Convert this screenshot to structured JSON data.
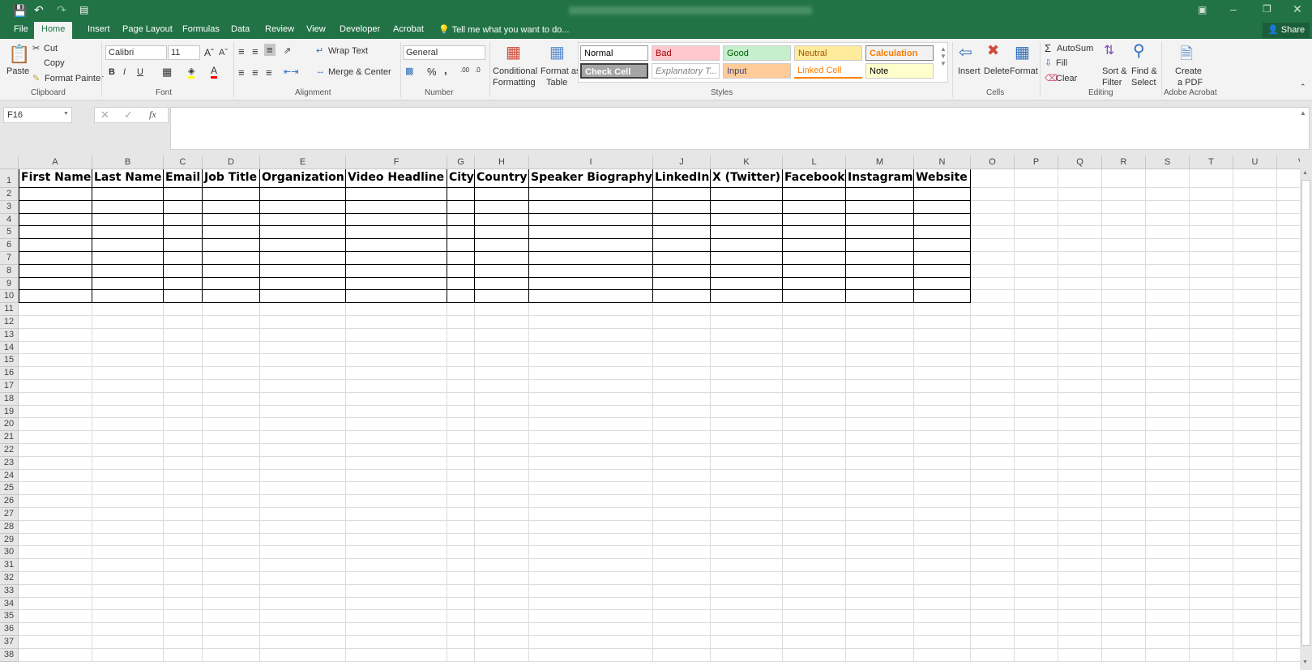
{
  "window": {
    "share": "Share"
  },
  "tabs": [
    "File",
    "Home",
    "Insert",
    "Page Layout",
    "Formulas",
    "Data",
    "Review",
    "View",
    "Developer",
    "Acrobat"
  ],
  "tell_me": "Tell me what you want to do...",
  "ribbon": {
    "clipboard": {
      "paste": "Paste",
      "cut": "Cut",
      "copy": "Copy",
      "format_painter": "Format Painter",
      "label": "Clipboard"
    },
    "font": {
      "name": "Calibri",
      "size": "11",
      "label": "Font",
      "bold": "B",
      "italic": "I",
      "underline": "U"
    },
    "alignment": {
      "wrap": "Wrap Text",
      "merge": "Merge & Center",
      "label": "Alignment"
    },
    "number": {
      "format": "General",
      "percent": "%",
      "comma": ",",
      "label": "Number"
    },
    "styles": {
      "conditional": "Conditional",
      "conditional2": "Formatting",
      "format_table": "Format as",
      "format_table2": "Table",
      "label": "Styles",
      "cells": [
        {
          "t": "Normal",
          "bg": "#ffffff",
          "fg": "#000000"
        },
        {
          "t": "Bad",
          "bg": "#ffc7ce",
          "fg": "#9c0006"
        },
        {
          "t": "Good",
          "bg": "#c6efce",
          "fg": "#006100"
        },
        {
          "t": "Neutral",
          "bg": "#ffeb9c",
          "fg": "#9c5700"
        },
        {
          "t": "Calculation",
          "bg": "#f2f2f2",
          "fg": "#fa7d00"
        },
        {
          "t": "Check Cell",
          "bg": "#a5a5a5",
          "fg": "#ffffff"
        },
        {
          "t": "Explanatory T...",
          "bg": "#ffffff",
          "fg": "#7f7f7f"
        },
        {
          "t": "Input",
          "bg": "#ffcc99",
          "fg": "#3f3f76"
        },
        {
          "t": "Linked Cell",
          "bg": "#ffffff",
          "fg": "#fa7d00"
        },
        {
          "t": "Note",
          "bg": "#ffffcc",
          "fg": "#000000"
        }
      ]
    },
    "cells": {
      "insert": "Insert",
      "delete": "Delete",
      "format": "Format",
      "label": "Cells"
    },
    "editing": {
      "autosum": "AutoSum",
      "fill": "Fill",
      "clear": "Clear",
      "sort": "Sort &",
      "sort2": "Filter",
      "find": "Find &",
      "find2": "Select",
      "label": "Editing"
    },
    "acrobat": {
      "create": "Create",
      "create2": "a PDF",
      "label": "Adobe Acrobat"
    }
  },
  "formula_bar": {
    "name_box": "F16",
    "fx": "fx",
    "value": ""
  },
  "sheet": {
    "columns": [
      "A",
      "B",
      "C",
      "D",
      "E",
      "F",
      "G",
      "H",
      "I",
      "J",
      "K",
      "L",
      "M",
      "N",
      "O",
      "P",
      "Q",
      "R",
      "S",
      "T",
      "U",
      "V"
    ],
    "headers": [
      "First Name",
      "Last Name",
      "Email",
      "Job Title",
      "Organization",
      "Video Headline",
      "City",
      "Country",
      "Speaker Biography",
      "LinkedIn",
      "X (Twitter)",
      "Facebook",
      "Instagram",
      "Website"
    ],
    "bordered_rows": 10,
    "visible_rows": 38
  },
  "colors": {
    "accent": "#217346"
  }
}
